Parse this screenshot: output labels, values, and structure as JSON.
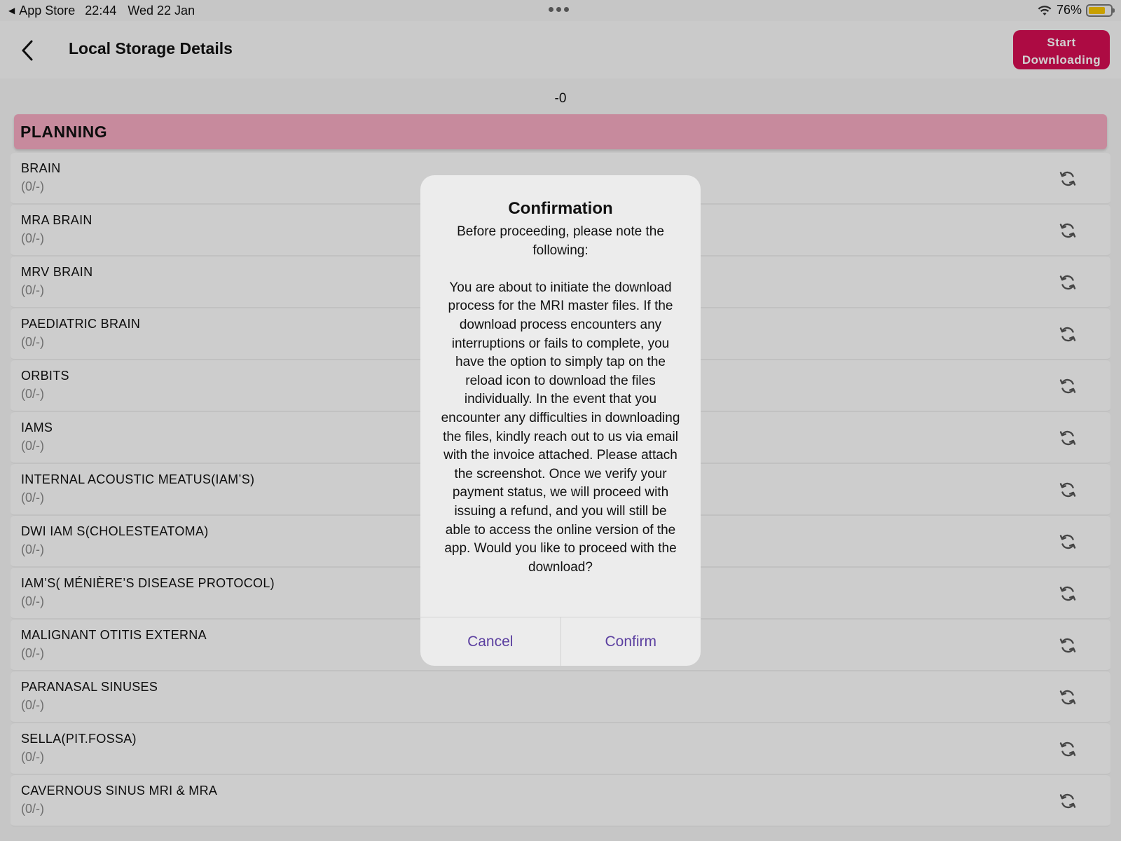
{
  "status_bar": {
    "back_app": "App Store",
    "time": "22:44",
    "date": "Wed 22 Jan",
    "battery": "76%",
    "battery_level": 0.76
  },
  "nav": {
    "title": "Local Storage Details",
    "start_button": "Start Downloading"
  },
  "progress_label": "-0",
  "section": {
    "title": "PLANNING"
  },
  "items": [
    {
      "name": "BRAIN",
      "count": "(0/-)"
    },
    {
      "name": "MRA BRAIN",
      "count": "(0/-)"
    },
    {
      "name": "MRV BRAIN",
      "count": "(0/-)"
    },
    {
      "name": "PAEDIATRIC BRAIN",
      "count": "(0/-)"
    },
    {
      "name": "ORBITS",
      "count": "(0/-)"
    },
    {
      "name": "IAMS",
      "count": "(0/-)"
    },
    {
      "name": "INTERNAL ACOUSTIC MEATUS(IAM’S)",
      "count": "(0/-)"
    },
    {
      "name": "DWI IAM S(CHOLESTEATOMA)",
      "count": "(0/-)"
    },
    {
      "name": "IAM’S( MÉNIÈRE’S DISEASE PROTOCOL)",
      "count": "(0/-)"
    },
    {
      "name": "MALIGNANT OTITIS EXTERNA",
      "count": "(0/-)"
    },
    {
      "name": "PARANASAL SINUSES",
      "count": "(0/-)"
    },
    {
      "name": "SELLA(PIT.FOSSA)",
      "count": "(0/-)"
    },
    {
      "name": "CAVERNOUS SINUS MRI & MRA",
      "count": "(0/-)"
    }
  ],
  "dialog": {
    "title": "Confirmation",
    "message": "Before proceeding, please note the following:\n\nYou are about to initiate the download process for the MRI master files. If the download process encounters any interruptions or fails to complete, you have the option to simply tap on the reload icon to download the files individually. In the event that you encounter any difficulties in downloading the files, kindly reach out to us via email with the invoice attached. Please attach the screenshot. Once we verify your payment status, we will proceed with issuing a refund, and you will still be able to access the online version of the app. Would you like to proceed with the download?",
    "cancel": "Cancel",
    "confirm": "Confirm"
  },
  "colors": {
    "accent": "#d40e52",
    "section_bg": "#f3a9c0",
    "dialog_button": "#5b3fa0"
  }
}
